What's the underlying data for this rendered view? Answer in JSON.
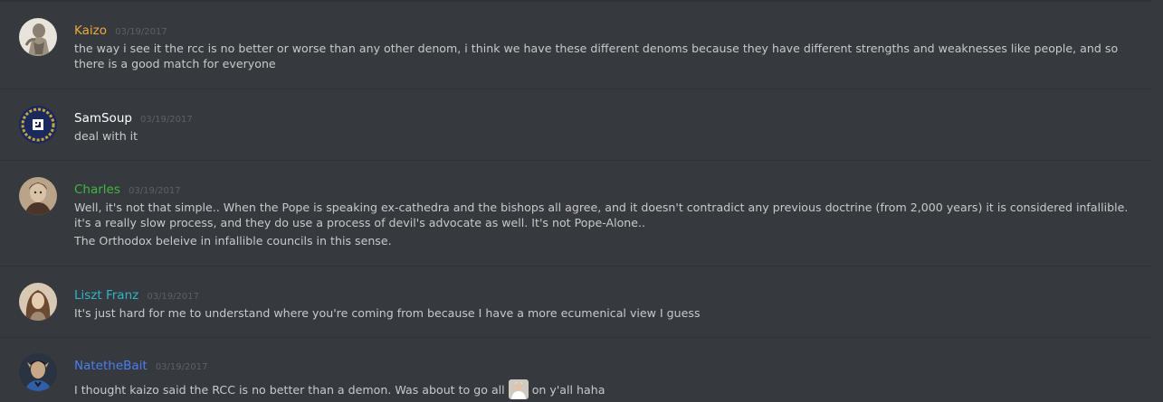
{
  "colors": {
    "kaizo": "#f0a83c",
    "samsoup": "#ffffff",
    "charles": "#3fb83f",
    "liszt": "#2fb5c8",
    "nate": "#4a7ef0",
    "timestamp": "#5d6066",
    "text": "#c8c9ca",
    "background": "#36393e"
  },
  "messages": [
    {
      "username": "Kaizo",
      "timestamp": "03/19/2017",
      "avatar_icon": "classical-statue-avatar",
      "lines": [
        "the way i see it the rcc is no better or worse than any other denom, i think we have these different denoms because they have different strengths and weaknesses like people, and so there is a good match for everyone"
      ]
    },
    {
      "username": "SamSoup",
      "timestamp": "03/19/2017",
      "avatar_icon": "laurel-emblem-avatar",
      "lines": [
        "deal with it"
      ]
    },
    {
      "username": "Charles",
      "timestamp": "03/19/2017",
      "avatar_icon": "portrait-avatar",
      "lines": [
        "Well, it's not that simple.. When the Pope is speaking ex-cathedra and the bishops all agree, and it doesn't contradict any previous doctrine (from 2,000 years) it is considered infallible. it's a really slow process, and they do use a process of devil's advocate as well. It's not Pope-Alone..",
        "The Orthodox beleive in infallible councils in this sense."
      ]
    },
    {
      "username": "Liszt Franz",
      "timestamp": "03/19/2017",
      "avatar_icon": "woman-portrait-avatar",
      "lines": [
        "It's just hard for me to understand where you're coming from because I have a more ecumenical view I guess"
      ]
    },
    {
      "username": "NatetheBait",
      "timestamp": "03/19/2017",
      "avatar_icon": "spock-avatar",
      "text_before_emoji": "I thought kaizo said the RCC is no better than a demon. Was about to go all",
      "emoji": "pope-emoji",
      "text_after_emoji": "on y'all haha"
    }
  ]
}
